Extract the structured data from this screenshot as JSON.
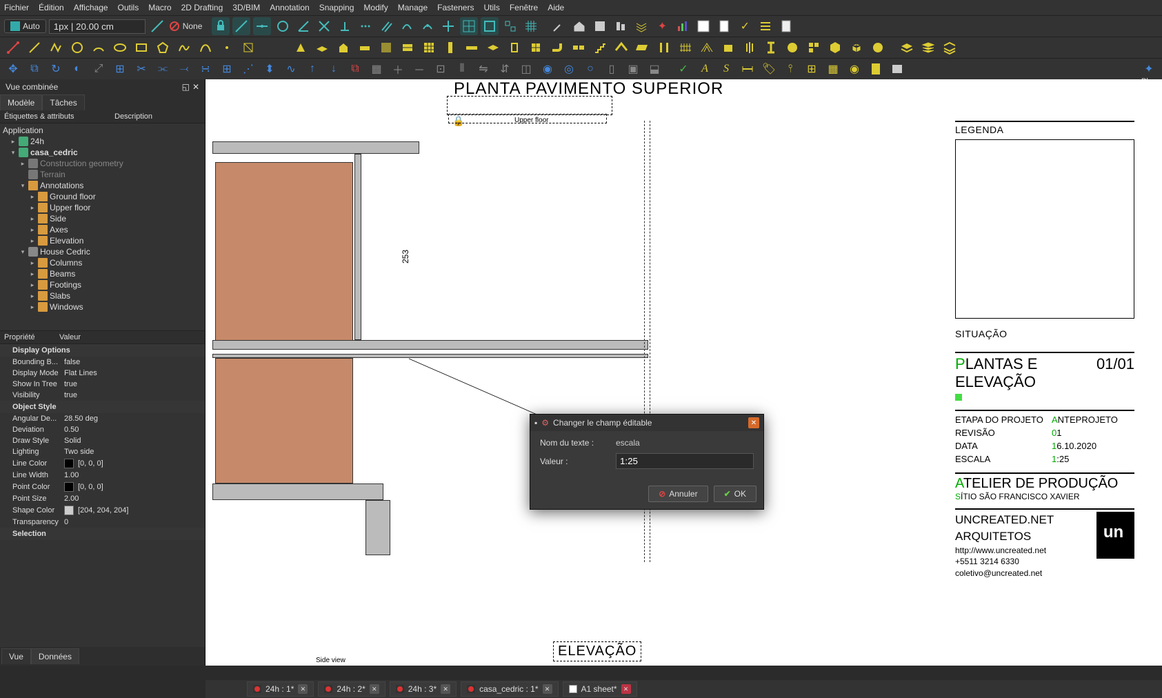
{
  "menu": [
    "Fichier",
    "Édition",
    "Affichage",
    "Outils",
    "Macro",
    "2D Drafting",
    "3D/BIM",
    "Annotation",
    "Snapping",
    "Modify",
    "Manage",
    "Fasteners",
    "Utils",
    "Fenêtre",
    "Aide"
  ],
  "toolbar1": {
    "auto": "Auto",
    "size": "1px | 20.00 cm",
    "none": "None"
  },
  "left_panel": {
    "title": "Vue combinée",
    "tabs": [
      "Modèle",
      "Tâches"
    ],
    "header1": "Étiquettes & attributs",
    "header2": "Description",
    "tree": {
      "app": "Application",
      "nodes": [
        {
          "d": 1,
          "arrow": "▸",
          "icon": "doc",
          "label": "24h"
        },
        {
          "d": 1,
          "arrow": "▾",
          "icon": "doc",
          "label": "casa_cedric",
          "bold": true
        },
        {
          "d": 2,
          "arrow": "▸",
          "icon": "grey",
          "label": "Construction geometry",
          "dim": true
        },
        {
          "d": 2,
          "arrow": "",
          "icon": "grey",
          "label": "Terrain",
          "dim": true
        },
        {
          "d": 2,
          "arrow": "▾",
          "icon": "folder",
          "label": "Annotations"
        },
        {
          "d": 3,
          "arrow": "▸",
          "icon": "folder",
          "label": "Ground floor"
        },
        {
          "d": 3,
          "arrow": "▸",
          "icon": "folder",
          "label": "Upper floor"
        },
        {
          "d": 3,
          "arrow": "▸",
          "icon": "folder",
          "label": "Side"
        },
        {
          "d": 3,
          "arrow": "▸",
          "icon": "folder",
          "label": "Axes"
        },
        {
          "d": 3,
          "arrow": "▸",
          "icon": "folder",
          "label": "Elevation"
        },
        {
          "d": 2,
          "arrow": "▾",
          "icon": "house",
          "label": "House Cedric"
        },
        {
          "d": 3,
          "arrow": "▸",
          "icon": "folder",
          "label": "Columns"
        },
        {
          "d": 3,
          "arrow": "▸",
          "icon": "folder",
          "label": "Beams"
        },
        {
          "d": 3,
          "arrow": "▸",
          "icon": "folder",
          "label": "Footings"
        },
        {
          "d": 3,
          "arrow": "▸",
          "icon": "folder",
          "label": "Slabs"
        },
        {
          "d": 3,
          "arrow": "▸",
          "icon": "folder",
          "label": "Windows"
        }
      ]
    },
    "prop_header": {
      "k": "Propriété",
      "v": "Valeur"
    },
    "props": [
      {
        "group": "Display Options"
      },
      {
        "k": "Bounding B...",
        "v": "false"
      },
      {
        "k": "Display Mode",
        "v": "Flat Lines"
      },
      {
        "k": "Show In Tree",
        "v": "true"
      },
      {
        "k": "Visibility",
        "v": "true"
      },
      {
        "group": "Object Style"
      },
      {
        "k": "Angular De...",
        "v": "28.50 deg"
      },
      {
        "k": "Deviation",
        "v": "0.50"
      },
      {
        "k": "Draw Style",
        "v": "Solid"
      },
      {
        "k": "Lighting",
        "v": "Two side"
      },
      {
        "k": "Line Color",
        "v": "[0, 0, 0]",
        "swatch": "black"
      },
      {
        "k": "Line Width",
        "v": "1.00"
      },
      {
        "k": "Point Color",
        "v": "[0, 0, 0]",
        "swatch": "black"
      },
      {
        "k": "Point Size",
        "v": "2.00"
      },
      {
        "k": "Shape Color",
        "v": "[204, 204, 204]",
        "swatch": "grey"
      },
      {
        "k": "Transparency",
        "v": "0"
      },
      {
        "group": "Selection"
      }
    ],
    "bottom_tabs": [
      "Vue",
      "Données"
    ]
  },
  "drawing": {
    "plan_title": "PLANTA PAVIMENTO SUPERIOR",
    "upper_floor": "Upper floor",
    "elev_title": "ELEVAÇÃO",
    "side_view": "Side view",
    "dim": "253"
  },
  "titleblock": {
    "legenda": "LEGENDA",
    "situacao": "SITUAÇÃO",
    "main_title": "PLANTAS E ELEVAÇÃO",
    "page": "01/01",
    "rows": [
      {
        "k": "ETAPA DO PROJETO",
        "v": "ANTEPROJETO"
      },
      {
        "k": "REVISÃO",
        "v": "01"
      },
      {
        "k": "DATA",
        "v": "16.10.2020"
      },
      {
        "k": "ESCALA",
        "v": "1:25"
      }
    ],
    "atelier": "ATELIER DE PRODUÇÃO",
    "sitio": "SÍTIO SÃO FRANCISCO XAVIER",
    "firm": "UNCREATED.NET ARQUITETOS",
    "contact": [
      "http://www.uncreated.net",
      "+5511 3214 6330",
      "coletivo@uncreated.net"
    ]
  },
  "dialog": {
    "title": "Changer le champ éditable",
    "name_label": "Nom du texte :",
    "name_value": "escala",
    "value_label": "Valeur :",
    "value_value": "1:25",
    "cancel": "Annuler",
    "ok": "OK"
  },
  "doc_tabs": [
    {
      "label": "24h : 1*",
      "fc": "#d33"
    },
    {
      "label": "24h : 2*",
      "fc": "#d33"
    },
    {
      "label": "24h : 3*",
      "fc": "#d33"
    },
    {
      "label": "casa_cedric : 1*",
      "fc": "#d33"
    },
    {
      "label": "A1 sheet*",
      "fc": "#fff",
      "active": true
    }
  ],
  "right_clip": "Pla"
}
